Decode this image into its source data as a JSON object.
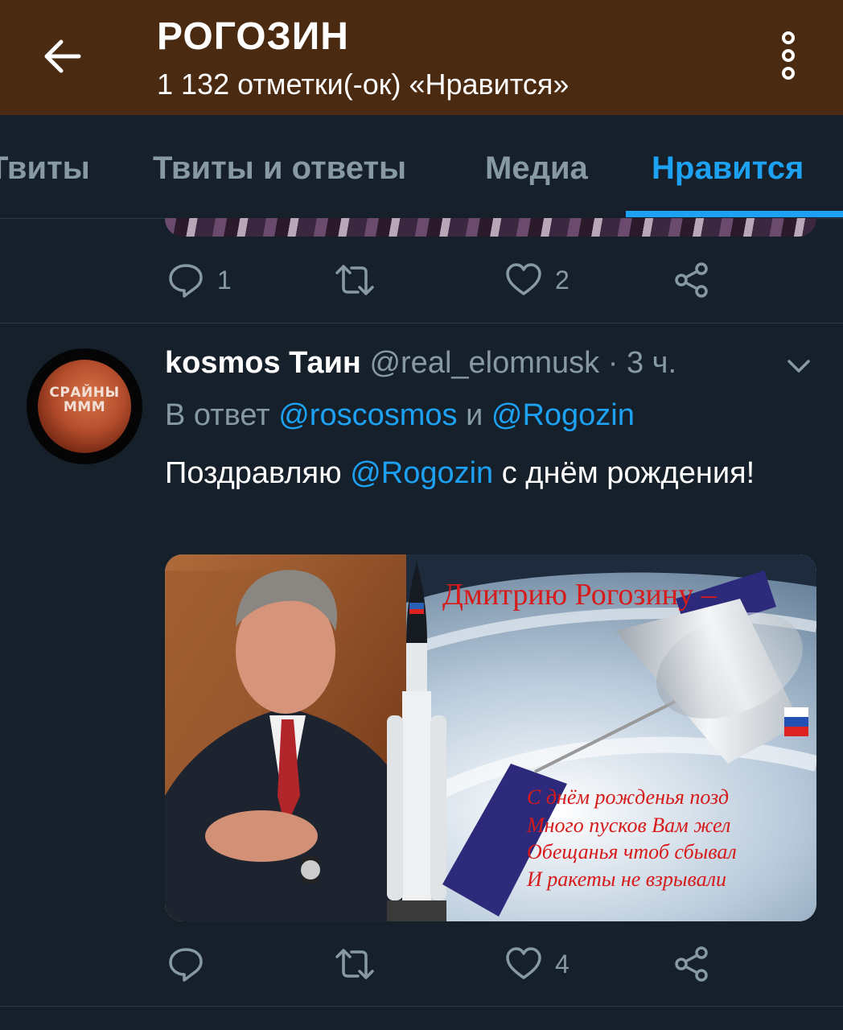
{
  "header": {
    "title": "РОГОЗИН",
    "subtitle": "1 132 отметки(-ок) «Нравится»",
    "back_icon": "arrow-left-icon",
    "more_icon": "more-vertical-icon",
    "bg_color": "#4a2a10"
  },
  "tabs": [
    {
      "label": "Твиты",
      "active": false
    },
    {
      "label": "Твиты и ответы",
      "active": false
    },
    {
      "label": "Медиа",
      "active": false
    },
    {
      "label": "Нравится",
      "active": true
    }
  ],
  "prev_tweet": {
    "actions": {
      "reply_count": "1",
      "retweet_count": "",
      "like_count": "2"
    }
  },
  "tweet": {
    "avatar_text": "СРАЙНЫ ММM",
    "name": "kosmos Таин",
    "handle": "@real_elomnusk",
    "dot": "·",
    "time": "3 ч.",
    "reply_prefix": "В ответ",
    "reply_user1": "@roscosmos",
    "reply_and": "и",
    "reply_user2": "@Rogozin",
    "text_before": "Поздравляю",
    "text_mention": "@Rogozin",
    "text_after": "с днём рождения!",
    "image": {
      "title": "Дмитрию Рогозину –",
      "poem": [
        "С днём рожденья позд",
        "Много пусков Вам жел",
        "Обещанья чтоб сбывал",
        "И ракеты не взрывали"
      ]
    },
    "actions": {
      "reply_count": "",
      "retweet_count": "",
      "like_count": "4"
    }
  },
  "colors": {
    "accent": "#1da1f2",
    "background": "#15202b",
    "muted": "#8899a6"
  }
}
